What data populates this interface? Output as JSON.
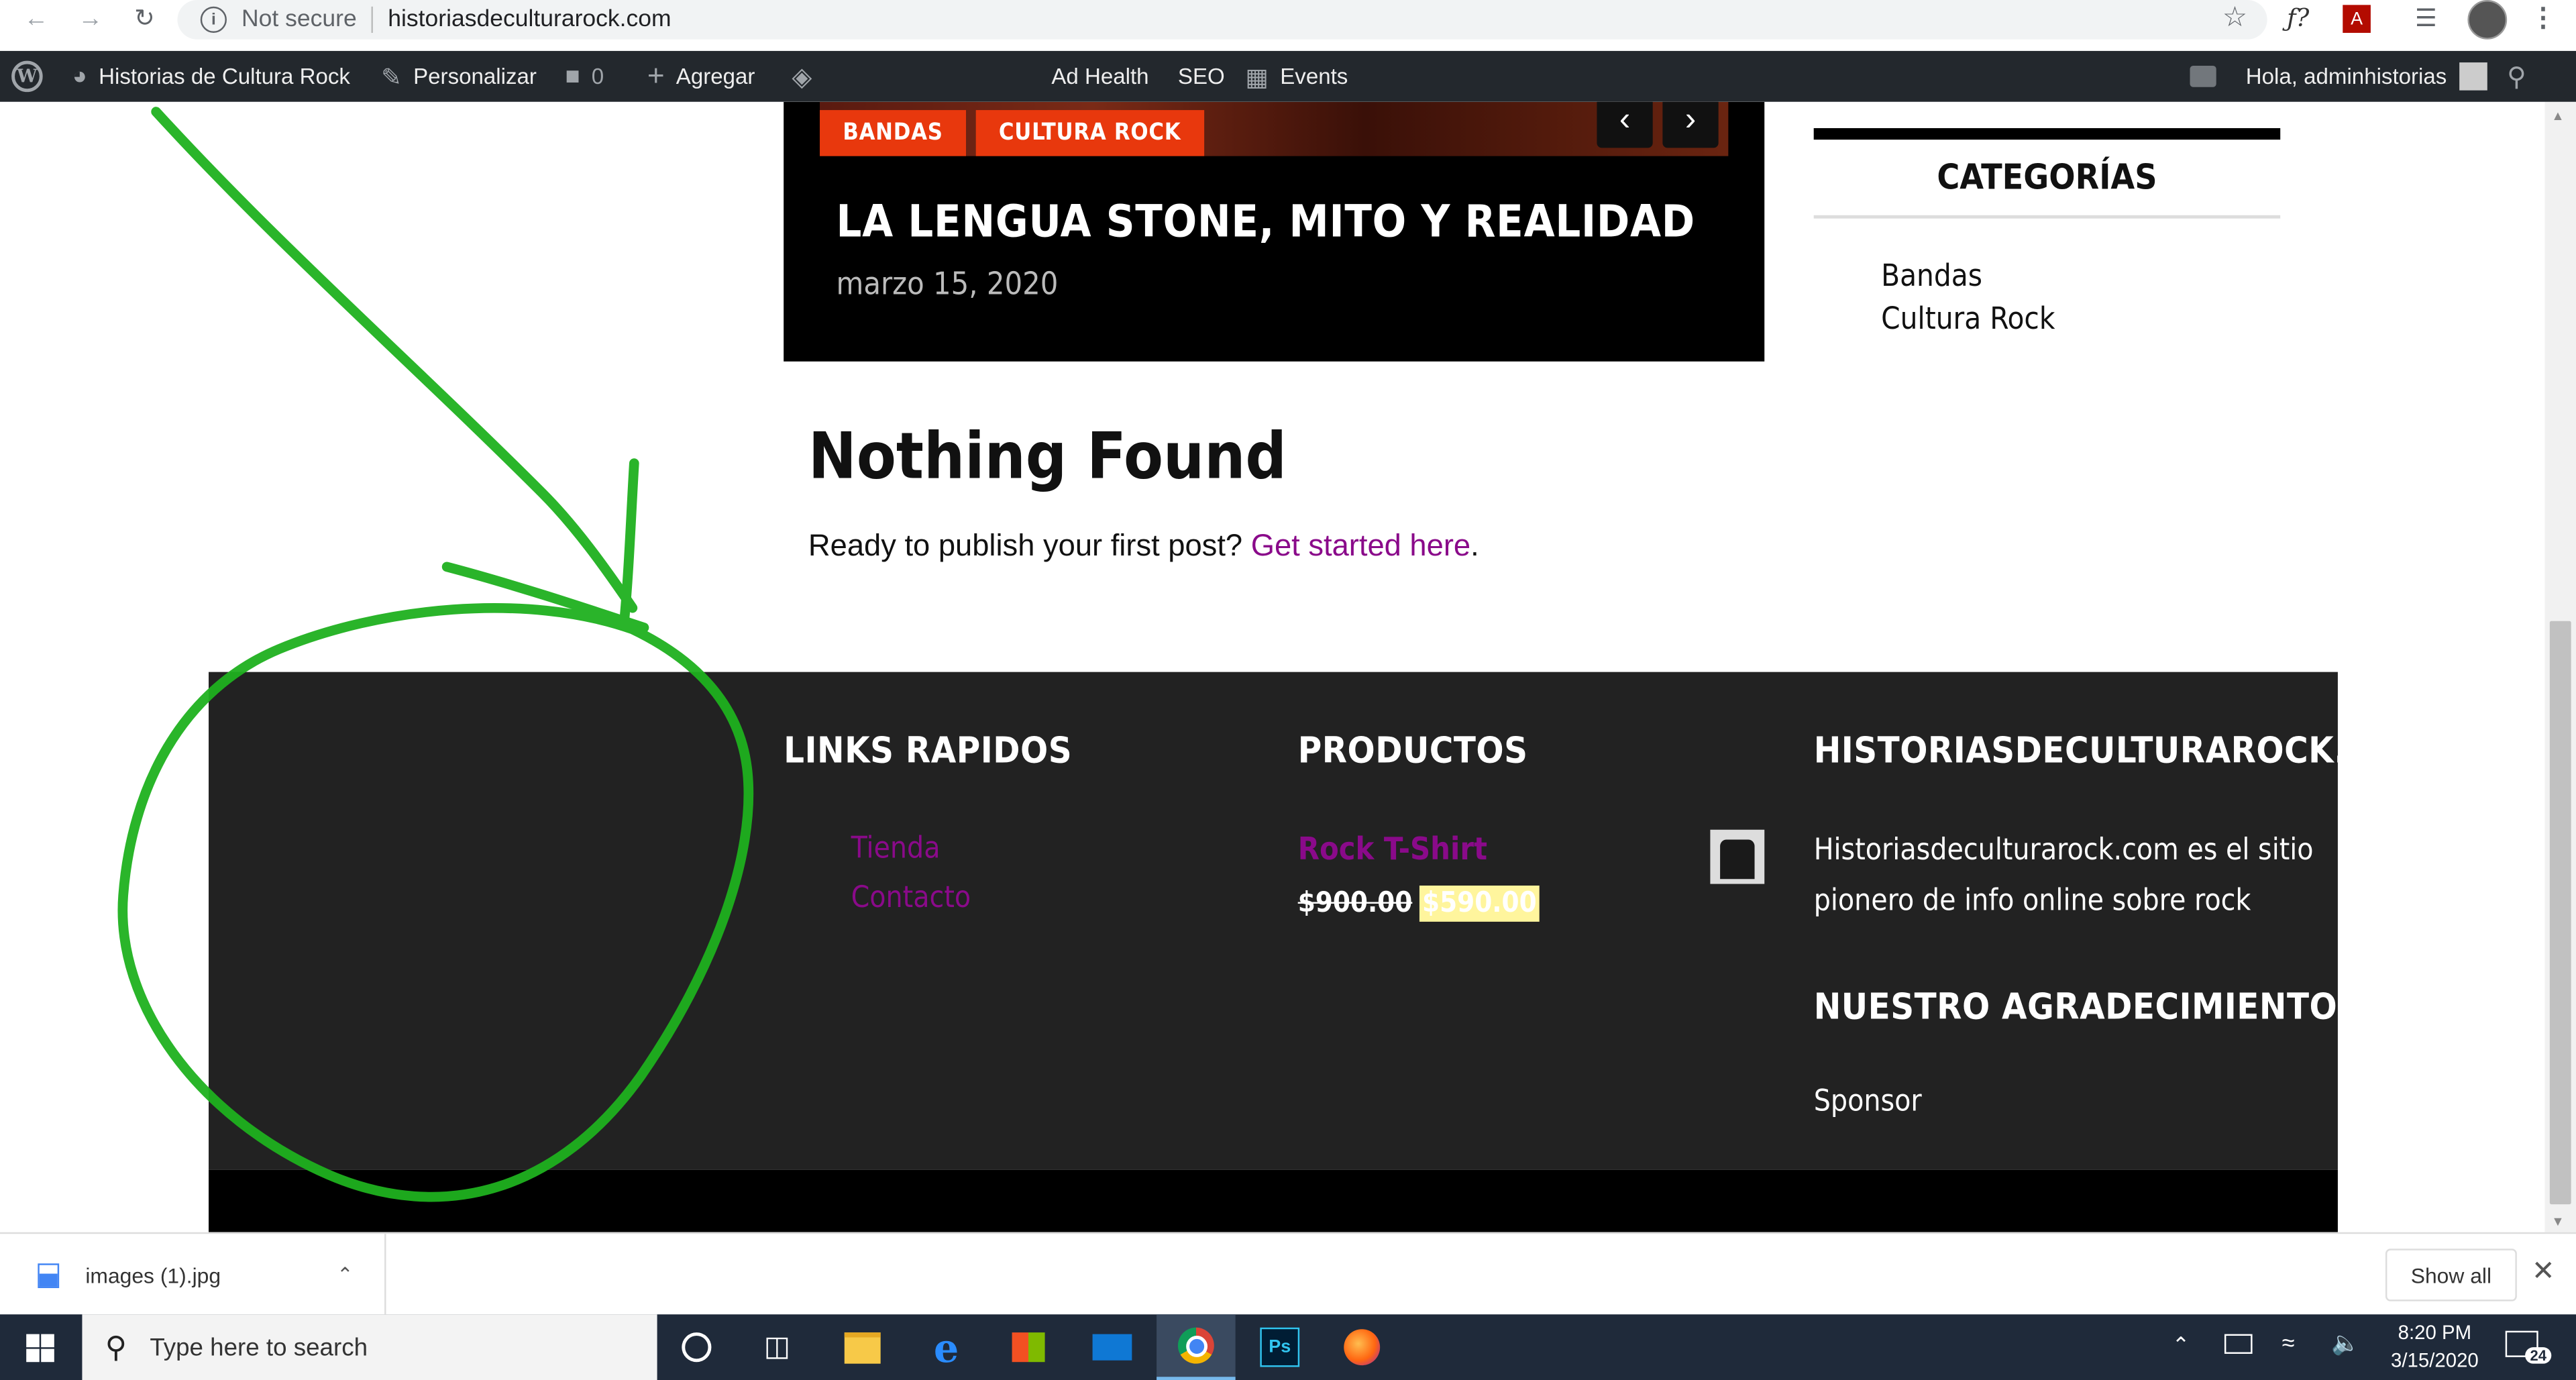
{
  "browser": {
    "back_icon": "arrow-left-icon",
    "security_label": "Not secure",
    "url": "historiasdeculturarock.com"
  },
  "adminbar": {
    "site_name": "Historias de Cultura Rock",
    "customize": "Personalizar",
    "comments_count": "0",
    "add_new": "Agregar",
    "ad_health": "Ad Health",
    "seo": "SEO",
    "events": "Events",
    "greeting": "Hola, adminhistorias"
  },
  "hero": {
    "tags": [
      "BANDAS",
      "CULTURA ROCK"
    ],
    "title": "LA LENGUA STONE, MITO Y REALIDAD",
    "date": "marzo 15, 2020"
  },
  "content": {
    "heading": "Nothing Found",
    "text": "Ready to publish your first post?",
    "link": "Get started here",
    "period": "."
  },
  "sidebar": {
    "title": "CATEGORÍAS",
    "categories": [
      "Bandas",
      "Cultura Rock"
    ]
  },
  "footer": {
    "links_title": "LINKS RAPIDOS",
    "links": [
      "Tienda",
      "Contacto"
    ],
    "products_title": "PRODUCTOS",
    "product_name": "Rock T-Shirt",
    "old_price": "$900.00",
    "new_price": "$590.00",
    "site_title": "HISTORIASDECULTURAROCK.COM",
    "site_desc_line1": "Historiasdeculturarock.com es el sitio",
    "site_desc_line2": "pionero de info online sobre rock",
    "thanks_title": "NUESTRO AGRADECIMIENTO",
    "sponsor": "Sponsor"
  },
  "download": {
    "file": "images (1).jpg",
    "show_all": "Show all"
  },
  "taskbar": {
    "search_placeholder": "Type here to search",
    "time": "8:20 PM",
    "date": "3/15/2020",
    "notifications": "24"
  },
  "colors": {
    "accent_tag": "#e8380d",
    "link_purple": "#8a0a8a",
    "annotation_green": "#1fb11f"
  }
}
